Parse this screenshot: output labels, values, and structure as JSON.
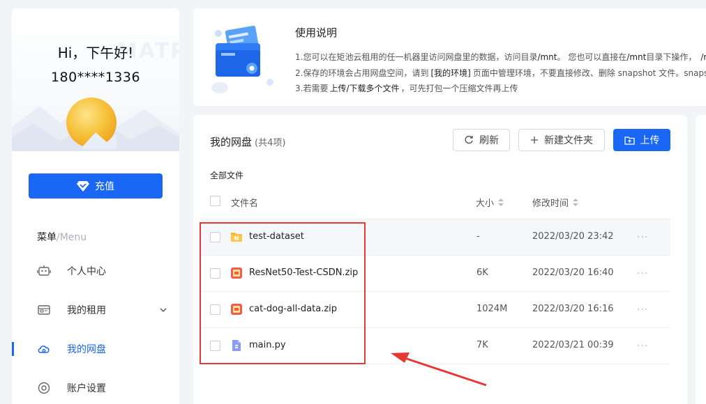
{
  "sidebar": {
    "watermark": "MATPOOL",
    "greeting": "Hi，下午好!",
    "phone": "180****1336",
    "recharge_label": "充值",
    "menu_title": "菜单",
    "menu_title_en": "/Menu",
    "items": [
      {
        "label": "个人中心",
        "icon": "robot-icon"
      },
      {
        "label": "我的租用",
        "icon": "server-icon",
        "expandable": true
      },
      {
        "label": "我的网盘",
        "icon": "cloud-disk-icon",
        "active": true
      },
      {
        "label": "账户设置",
        "icon": "settings-icon"
      }
    ]
  },
  "info": {
    "title": "使用说明",
    "line1_a": "1.您可以在矩池云租用的任一机器里访问网盘里的数据，访问目录",
    "line1_b": "/mnt",
    "line1_c": "。 您也可以直接在",
    "line1_d": "/mnt",
    "line1_e": "目录下操作，",
    "line1_f": "/r",
    "line2_a": "2.保存的环境会占用网盘空间，请到",
    "line2_b": "[我的环境]",
    "line2_c": "页面中管理环境，不要直接修改、删除 snapshot 文件。snapshot",
    "line3_a": "3.若需要",
    "line3_b": "上传/下载多个文件",
    "line3_c": "，可先打包一个压缩文件再上传"
  },
  "disk": {
    "title": "我的网盘",
    "count": "(共4项)",
    "refresh_label": "刷新",
    "new_folder_label": "新建文件夹",
    "upload_label": "上传",
    "breadcrumb": "全部文件",
    "columns": {
      "name": "文件名",
      "size": "大小",
      "time": "修改时间"
    },
    "files": [
      {
        "name": "test-dataset",
        "size": "-",
        "time": "2022/03/20 23:42",
        "type": "folder"
      },
      {
        "name": "ResNet50-Test-CSDN.zip",
        "size": "6K",
        "time": "2022/03/20 16:40",
        "type": "zip"
      },
      {
        "name": "cat-dog-all-data.zip",
        "size": "1024M",
        "time": "2022/03/20 16:16",
        "type": "zip"
      },
      {
        "name": "main.py",
        "size": "7K",
        "time": "2022/03/21 00:39",
        "type": "python"
      }
    ],
    "more_symbol": "···"
  },
  "colors": {
    "accent": "#1a66f5",
    "annotation": "#e53935",
    "folder": "#f7b731",
    "zip": "#f05a4f"
  }
}
